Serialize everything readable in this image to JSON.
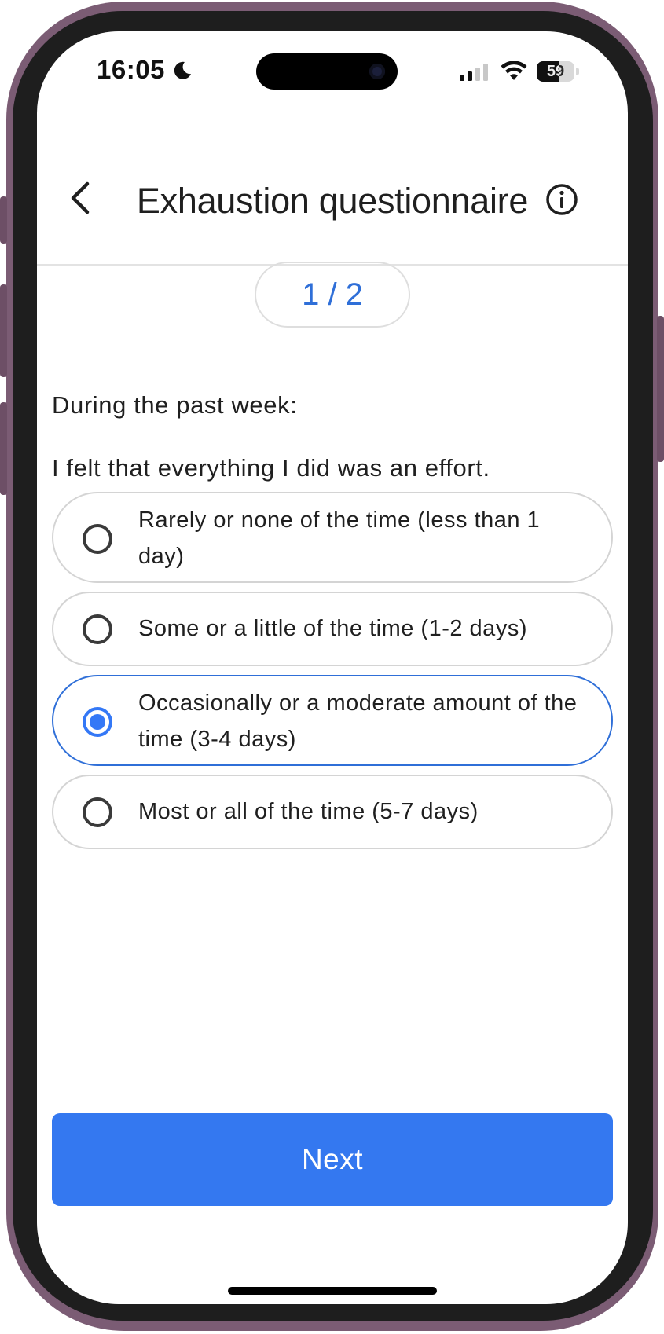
{
  "status_bar": {
    "time": "16:05",
    "battery": "59",
    "battery_level": 0.59
  },
  "header": {
    "title": "Exhaustion questionnaire"
  },
  "progress": {
    "label": "1 / 2"
  },
  "question": {
    "prompt": "During the past week:",
    "text": "I felt that everything I did was an effort."
  },
  "options": [
    {
      "label": "Rarely or none of the time (less than 1 day)",
      "selected": false
    },
    {
      "label": "Some or a little of the time (1-2 days)",
      "selected": false
    },
    {
      "label": "Occasionally or a moderate amount of the time (3-4 days)",
      "selected": true
    },
    {
      "label": "Most or all of the time (5-7 days)",
      "selected": false
    }
  ],
  "actions": {
    "next_label": "Next"
  },
  "colors": {
    "accent": "#3478f0",
    "progress_text": "#2f6fd8",
    "frame": "#7b5c74"
  },
  "icons": {
    "back": "chevron-left-icon",
    "info": "info-icon",
    "moon": "moon-icon",
    "signal": "cellular-signal-icon",
    "wifi": "wifi-icon",
    "battery": "battery-icon"
  }
}
